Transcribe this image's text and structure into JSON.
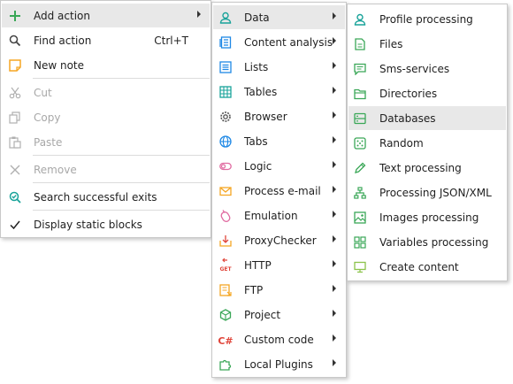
{
  "menu1": {
    "add_action": "Add action",
    "find_action": "Find action",
    "find_shortcut": "Ctrl+T",
    "new_note": "New note",
    "cut": "Cut",
    "copy": "Copy",
    "paste": "Paste",
    "remove": "Remove",
    "search_exits": "Search successful exits",
    "display_static": "Display static blocks"
  },
  "menu2": {
    "data": "Data",
    "content_analysis": "Content analysis",
    "lists": "Lists",
    "tables": "Tables",
    "browser": "Browser",
    "tabs": "Tabs",
    "logic": "Logic",
    "process_email": "Process e-mail",
    "emulation": "Emulation",
    "proxychecker": "ProxyChecker",
    "http": "HTTP",
    "ftp": "FTP",
    "project": "Project",
    "custom_code": "Custom code",
    "local_plugins": "Local Plugins"
  },
  "menu3": {
    "profile_processing": "Profile processing",
    "files": "Files",
    "sms_services": "Sms-services",
    "directories": "Directories",
    "databases": "Databases",
    "random": "Random",
    "text_processing": "Text processing",
    "processing_json": "Processing JSON/XML",
    "images_processing": "Images processing",
    "variables_processing": "Variables processing",
    "create_content": "Create content"
  },
  "icon_labels": {
    "get": "GET",
    "csharp": "C#"
  },
  "colors": {
    "green": "#3aa757",
    "blue": "#1e88e5",
    "teal": "#19a39a",
    "orange": "#f5a623",
    "pink": "#e06aa0",
    "red": "#e0453a",
    "highlight": "#e8e8e8"
  }
}
